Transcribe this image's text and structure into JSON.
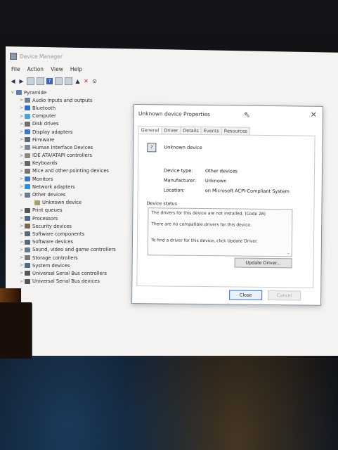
{
  "window": {
    "title": "Device Manager"
  },
  "menu": [
    "File",
    "Action",
    "View",
    "Help"
  ],
  "tree": {
    "root": "Pyramide",
    "items": [
      {
        "label": "Audio inputs and outputs",
        "color": "#6b7f94"
      },
      {
        "label": "Bluetooth",
        "color": "#2f6fd0"
      },
      {
        "label": "Computer",
        "color": "#4aa3d8"
      },
      {
        "label": "Disk drives",
        "color": "#707070"
      },
      {
        "label": "Display adapters",
        "color": "#3a78c4"
      },
      {
        "label": "Firmware",
        "color": "#5a6a7a"
      },
      {
        "label": "Human Interface Devices",
        "color": "#7a8a9a"
      },
      {
        "label": "IDE ATA/ATAPI controllers",
        "color": "#888888"
      },
      {
        "label": "Keyboards",
        "color": "#666666"
      },
      {
        "label": "Mice and other pointing devices",
        "color": "#777777"
      },
      {
        "label": "Monitors",
        "color": "#3a78c4"
      },
      {
        "label": "Network adapters",
        "color": "#2f8fd0"
      },
      {
        "label": "Other devices",
        "color": "#6a7a8a",
        "expanded": true
      },
      {
        "label": "Unknown device",
        "color": "#a0a070",
        "child": true
      },
      {
        "label": "Print queues",
        "color": "#555555"
      },
      {
        "label": "Processors",
        "color": "#4a6a8a"
      },
      {
        "label": "Security devices",
        "color": "#7a6a5a"
      },
      {
        "label": "Software components",
        "color": "#5a6a7a"
      },
      {
        "label": "Software devices",
        "color": "#5a6a7a"
      },
      {
        "label": "Sound, video and game controllers",
        "color": "#6a7a8a"
      },
      {
        "label": "Storage controllers",
        "color": "#7a7a7a"
      },
      {
        "label": "System devices",
        "color": "#4a6a8a"
      },
      {
        "label": "Universal Serial Bus controllers",
        "color": "#555555"
      },
      {
        "label": "Universal Serial Bus devices",
        "color": "#555555"
      }
    ]
  },
  "dialog": {
    "title": "Unknown device Properties",
    "tabs": [
      "General",
      "Driver",
      "Details",
      "Events",
      "Resources"
    ],
    "device_name": "Unknown device",
    "props": [
      {
        "label": "Device type:",
        "value": "Other devices"
      },
      {
        "label": "Manufacturer:",
        "value": "Unknown"
      },
      {
        "label": "Location:",
        "value": "on Microsoft ACPI-Compliant System"
      }
    ],
    "status_label": "Device status",
    "status_lines": [
      "The drivers for this device are not installed. (Code 28)",
      "There are no compatible drivers for this device.",
      "To find a driver for this device, click Update Driver."
    ],
    "update_button": "Update Driver...",
    "close_button": "Close",
    "cancel_button": "Cancel"
  }
}
